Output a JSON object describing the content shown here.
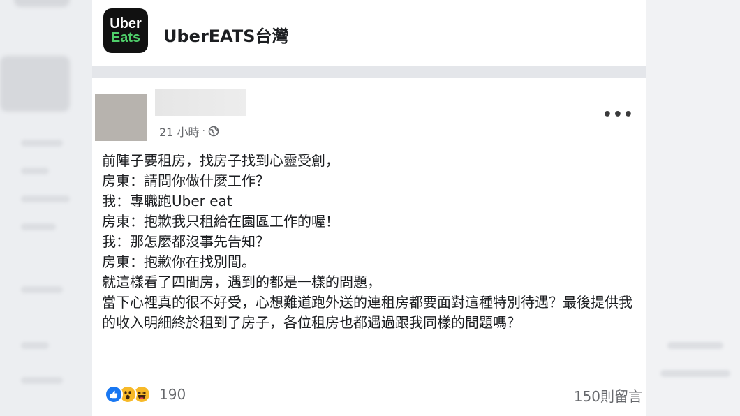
{
  "group": {
    "logo_line1": "Uber",
    "logo_line2": "Eats",
    "name": "UberEATS台灣"
  },
  "post": {
    "timestamp": "21 小時",
    "audience_icon": "globe-icon",
    "more_icon": "more-options-icon",
    "lines": [
      "前陣子要租房，找房子找到心靈受創，",
      "房東：請問你做什麼工作？",
      "我：專職跑Uber eat",
      "房東：抱歉我只租給在園區工作的喔！",
      "我：那怎麼都沒事先告知？",
      "房東：抱歉你在找別間。",
      "就這樣看了四間房，遇到的都是一樣的問題，",
      "當下心裡真的很不好受，心想難道跑外送的連租房都要面對這種特別待遇？最後提供我的收入明細終於租到了房子，各位租房也都遇過跟我同樣的問題嗎？"
    ],
    "reactions": {
      "icons": [
        "like-icon",
        "wow-icon",
        "haha-icon"
      ],
      "count": "190"
    },
    "comments_label": "150則留言"
  },
  "colors": {
    "facebook_blue": "#1877f2",
    "reaction_yellow": "#f7b928",
    "uber_green": "#4fcf6a"
  }
}
